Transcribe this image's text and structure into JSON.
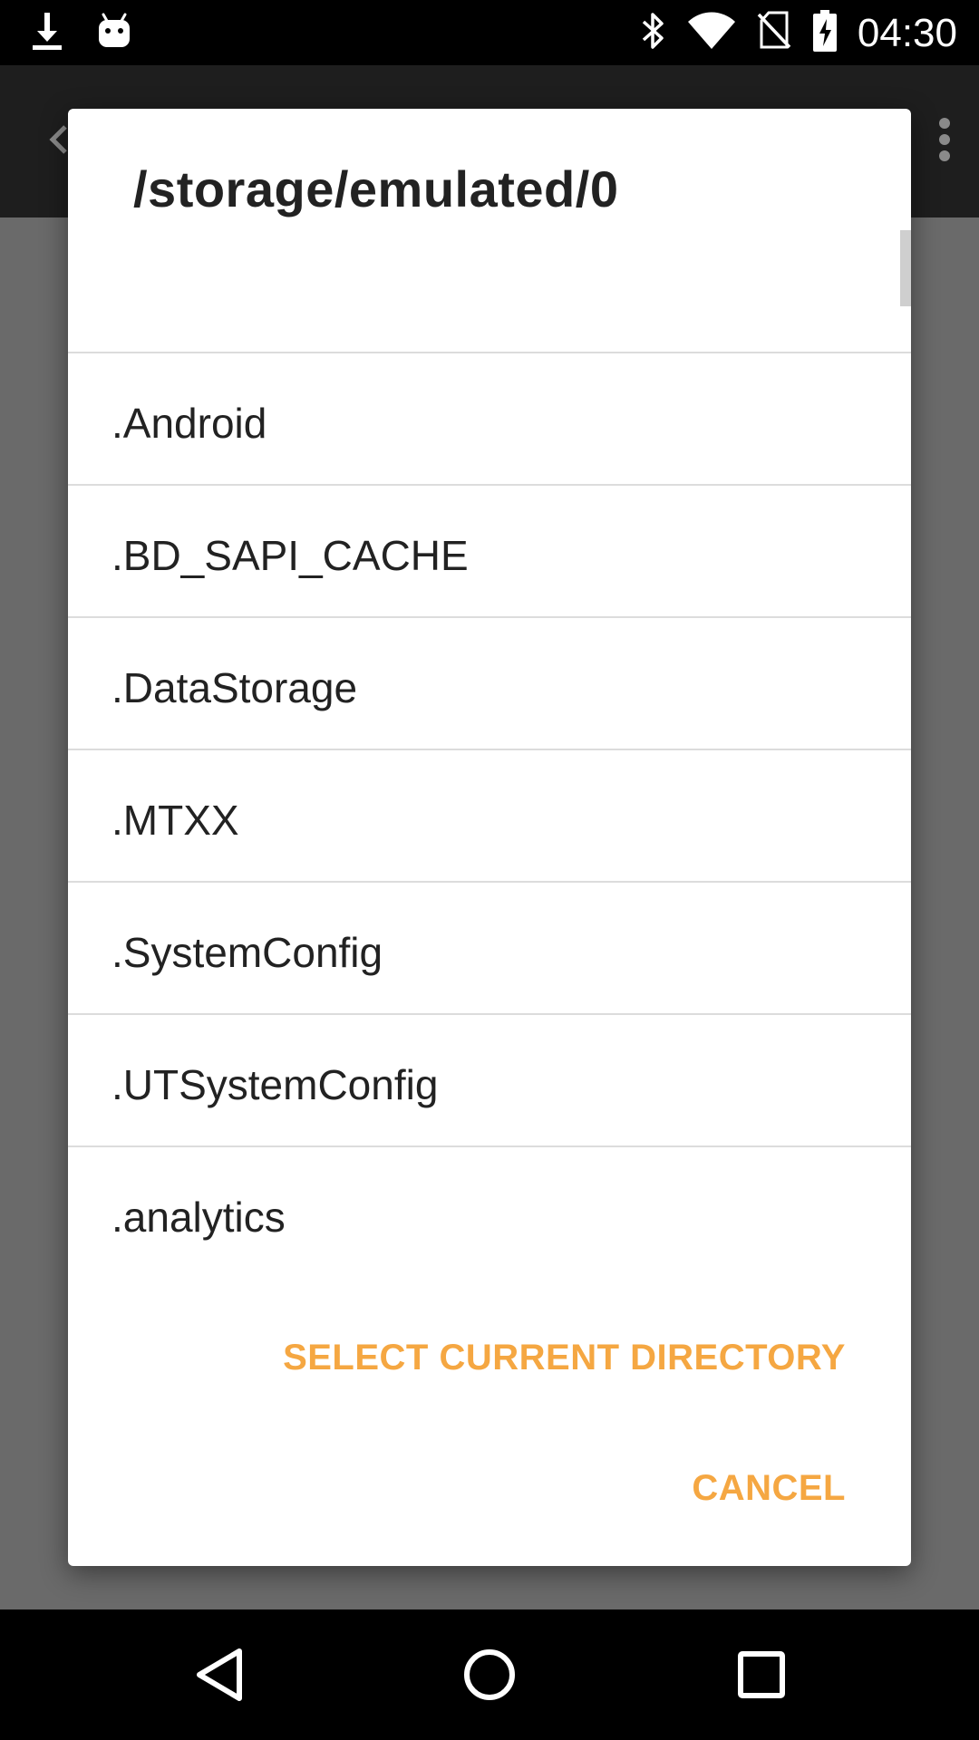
{
  "status_bar": {
    "time": "04:30",
    "left_icons": [
      "download-icon",
      "android-debug-icon"
    ],
    "right_icons": [
      "bluetooth-icon",
      "wifi-icon",
      "no-sim-icon",
      "battery-charging-icon"
    ]
  },
  "dialog": {
    "title": "/storage/emulated/0",
    "items": [
      {
        "label": ".."
      },
      {
        "label": ".Android"
      },
      {
        "label": ".BD_SAPI_CACHE"
      },
      {
        "label": ".DataStorage"
      },
      {
        "label": ".MTXX"
      },
      {
        "label": ".SystemConfig"
      },
      {
        "label": ".UTSystemConfig"
      },
      {
        "label": ".analytics"
      }
    ],
    "select_button": "SELECT CURRENT DIRECTORY",
    "cancel_button": "CANCEL"
  },
  "nav_bar": {
    "icons": [
      "back-icon",
      "home-icon",
      "recents-icon"
    ]
  },
  "colors": {
    "accent": "#f5a742",
    "scrim": "#6b6b6b",
    "status_bar": "#000000"
  }
}
